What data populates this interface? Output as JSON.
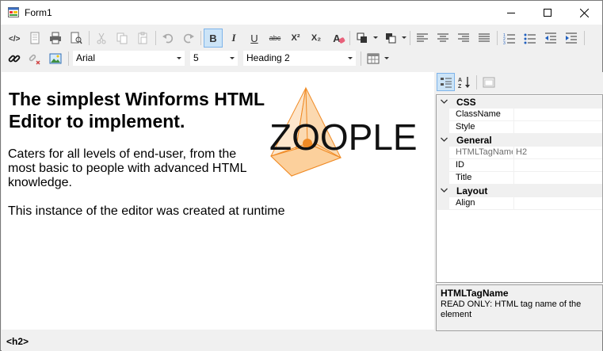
{
  "window": {
    "title": "Form1",
    "controls": [
      "minimize-icon",
      "maximize-icon",
      "close-icon"
    ]
  },
  "toolbar_top": {
    "buttons": [
      "html-source-icon",
      "document-icon",
      "print-icon",
      "print-preview-icon",
      "cut-icon",
      "copy-icon",
      "paste-icon",
      "undo-icon",
      "redo-icon",
      "bold-icon",
      "italic-icon",
      "underline-icon",
      "strikethrough-icon",
      "superscript-icon",
      "subscript-icon",
      "clear-format-icon",
      "fore-color-icon",
      "back-color-icon",
      "align-left-icon",
      "align-center-icon",
      "align-right-icon",
      "justify-icon",
      "numbered-list-icon",
      "bulleted-list-icon",
      "outdent-icon",
      "indent-icon"
    ],
    "bold": "B",
    "italic": "I",
    "underline": "U",
    "strike": "abc",
    "superscript": "X²",
    "subscript": "X₂",
    "clear_format": "A",
    "active": "bold"
  },
  "toolbar_second": {
    "font_family": "Arial",
    "font_size": "5",
    "block_format": "Heading 2",
    "buttons": [
      "link-icon",
      "unlink-icon",
      "image-icon",
      "table-icon"
    ]
  },
  "editor": {
    "heading": "The simplest Winforms HTML Editor to implement.",
    "paragraph1": "Caters for all levels of end-user, from the most basic to people with advanced HTML knowledge.",
    "paragraph2": "This instance of the editor was created at runtime",
    "logo_text": "ZOOPLE",
    "logo_colors": {
      "primary": "#f08a24",
      "line": "#222222",
      "fill": "#fbd9b0"
    }
  },
  "property_grid": {
    "toolbar": [
      "categorized-icon",
      "alphabetical-icon",
      "property-pages-icon"
    ],
    "categories": [
      {
        "name": "CSS",
        "properties": [
          {
            "name": "ClassName",
            "value": "",
            "readonly": false
          },
          {
            "name": "Style",
            "value": "",
            "readonly": false
          }
        ]
      },
      {
        "name": "General",
        "properties": [
          {
            "name": "HTMLTagName",
            "value": "H2",
            "readonly": true
          },
          {
            "name": "ID",
            "value": "",
            "readonly": false
          },
          {
            "name": "Title",
            "value": "",
            "readonly": false
          }
        ]
      },
      {
        "name": "Layout",
        "properties": [
          {
            "name": "Align",
            "value": "",
            "readonly": false
          }
        ]
      }
    ],
    "help_title": "HTMLTagName",
    "help_description": "READ ONLY: HTML tag name of the element"
  },
  "statusbar": {
    "tag": "<h2>"
  }
}
